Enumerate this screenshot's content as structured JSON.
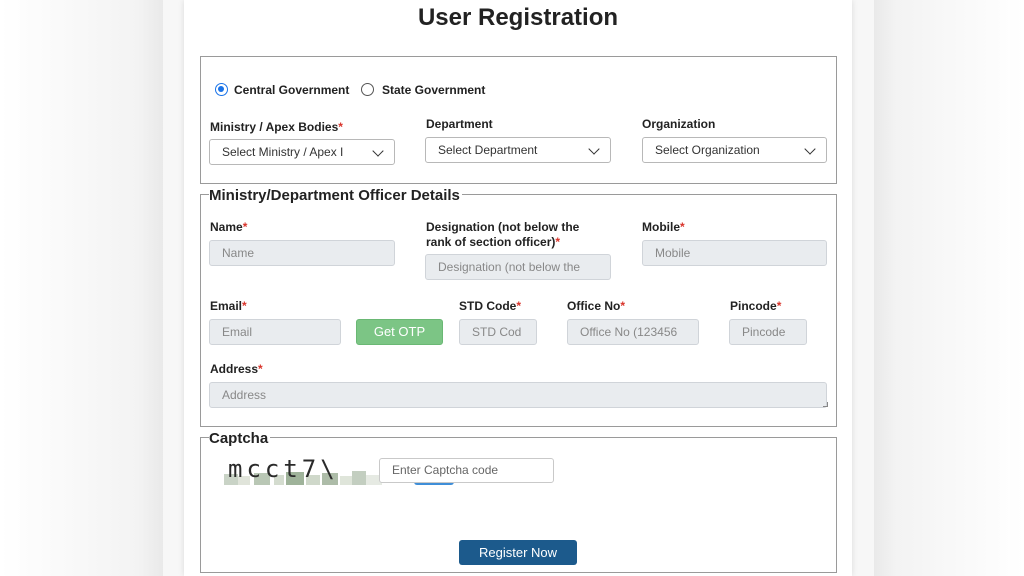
{
  "page": {
    "title": "User Registration"
  },
  "gov_type": {
    "options": [
      {
        "label": "Central Government",
        "selected": true
      },
      {
        "label": "State Government",
        "selected": false
      }
    ]
  },
  "selectors": {
    "ministry": {
      "label": "Ministry / Apex Bodies",
      "required": "*",
      "value": "Select Ministry / Apex I"
    },
    "department": {
      "label": "Department",
      "value": "Select Department"
    },
    "organization": {
      "label": "Organization",
      "value": "Select Organization"
    }
  },
  "officer": {
    "legend": "Ministry/Department Officer Details",
    "name": {
      "label": "Name",
      "required": "*",
      "placeholder": "Name"
    },
    "designation": {
      "label_line1": "Designation (not below the",
      "label_line2": "rank of section officer)",
      "required": "*",
      "placeholder": "Designation (not below the"
    },
    "mobile": {
      "label": "Mobile",
      "required": "*",
      "placeholder": "Mobile"
    },
    "email": {
      "label": "Email",
      "required": "*",
      "placeholder": "Email"
    },
    "get_otp": "Get OTP",
    "std_code": {
      "label": "STD Code",
      "required": "*",
      "placeholder": "STD Cod"
    },
    "office_no": {
      "label": "Office No",
      "required": "*",
      "placeholder": "Office No (123456"
    },
    "pincode": {
      "label": "Pincode",
      "required": "*",
      "placeholder": "Pincode"
    },
    "address": {
      "label": "Address",
      "required": "*",
      "placeholder": "Address"
    }
  },
  "captcha": {
    "legend": "Captcha",
    "image_text": "mcct7\\",
    "placeholder": "Enter Captcha code"
  },
  "register_button": "Register Now",
  "colors": {
    "primary": "#1c5a8c",
    "otp": "#7cc585",
    "required": "#d9342b",
    "radio": "#1a73e8"
  }
}
